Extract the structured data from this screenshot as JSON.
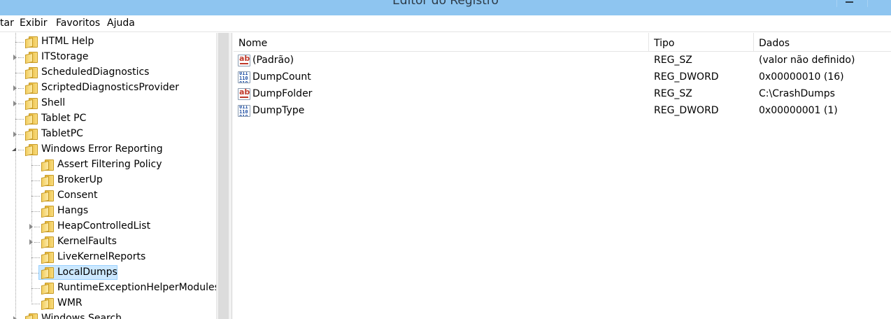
{
  "window": {
    "title": "Editor do Registro"
  },
  "menu": {
    "items": [
      "tar",
      "Exibir",
      "Favoritos",
      "Ajuda"
    ]
  },
  "tree": {
    "nodes": [
      {
        "label": "HTML Help",
        "expandable": false
      },
      {
        "label": "ITStorage",
        "expandable": true
      },
      {
        "label": "ScheduledDiagnostics",
        "expandable": false
      },
      {
        "label": "ScriptedDiagnosticsProvider",
        "expandable": true
      },
      {
        "label": "Shell",
        "expandable": true
      },
      {
        "label": "Tablet PC",
        "expandable": false
      },
      {
        "label": "TabletPC",
        "expandable": true
      },
      {
        "label": "Windows Error Reporting",
        "expandable": true,
        "expanded": true
      },
      {
        "label": "Assert Filtering Policy",
        "expandable": false
      },
      {
        "label": "BrokerUp",
        "expandable": false
      },
      {
        "label": "Consent",
        "expandable": false
      },
      {
        "label": "Hangs",
        "expandable": false
      },
      {
        "label": "HeapControlledList",
        "expandable": true
      },
      {
        "label": "KernelFaults",
        "expandable": true
      },
      {
        "label": "LiveKernelReports",
        "expandable": false
      },
      {
        "label": "LocalDumps",
        "expandable": false,
        "selected": true
      },
      {
        "label": "RuntimeExceptionHelperModules",
        "expandable": false
      },
      {
        "label": "WMR",
        "expandable": false
      },
      {
        "label": "Windows Search",
        "expandable": false
      }
    ]
  },
  "list": {
    "columns": [
      "Nome",
      "Tipo",
      "Dados"
    ],
    "rows": [
      {
        "icon": "string-value-icon",
        "name": "(Padrão)",
        "type": "REG_SZ",
        "data": "(valor não definido)"
      },
      {
        "icon": "binary-value-icon",
        "name": "DumpCount",
        "type": "REG_DWORD",
        "data": "0x00000010 (16)"
      },
      {
        "icon": "string-value-icon",
        "name": "DumpFolder",
        "type": "REG_SZ",
        "data": "C:\\CrashDumps"
      },
      {
        "icon": "binary-value-icon",
        "name": "DumpType",
        "type": "REG_DWORD",
        "data": "0x00000001 (1)"
      }
    ]
  },
  "colors": {
    "titlebar": "#8ec5f0",
    "selection": "#cce8ff",
    "selection_border": "#99d1ff"
  }
}
